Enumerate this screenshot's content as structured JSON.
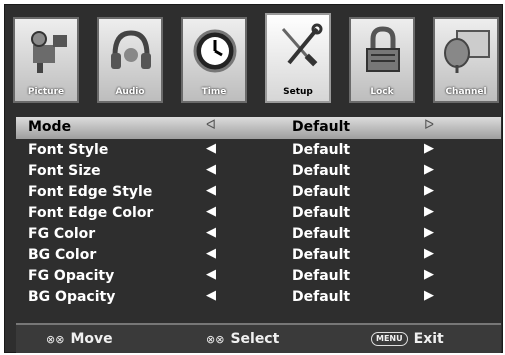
{
  "tabs": [
    {
      "label": "Picture",
      "icon": "camera-icon"
    },
    {
      "label": "Audio",
      "icon": "headphones-icon"
    },
    {
      "label": "Time",
      "icon": "clock-icon"
    },
    {
      "label": "Setup",
      "icon": "wrench-screwdriver-icon",
      "active": true
    },
    {
      "label": "Lock",
      "icon": "padlock-icon"
    },
    {
      "label": "Channel",
      "icon": "satellite-dish-icon"
    }
  ],
  "rows": [
    {
      "name": "Mode",
      "value": "Default",
      "selected": true
    },
    {
      "name": "Font Style",
      "value": "Default"
    },
    {
      "name": "Font Size",
      "value": "Default"
    },
    {
      "name": "Font Edge Style",
      "value": "Default"
    },
    {
      "name": "Font Edge Color",
      "value": "Default"
    },
    {
      "name": "FG Color",
      "value": "Default"
    },
    {
      "name": "BG Color",
      "value": "Default"
    },
    {
      "name": "FG Opacity",
      "value": "Default"
    },
    {
      "name": "BG Opacity",
      "value": "Default"
    }
  ],
  "arrows": {
    "left": "◀",
    "right": "▶",
    "left_sel": "ᐊ",
    "right_sel": "ᐅ"
  },
  "footer": {
    "move": {
      "symbol": "⊗⊗",
      "label": "Move"
    },
    "select": {
      "symbol": "⊗⊗",
      "label": "Select"
    },
    "exit": {
      "key": "MENU",
      "label": "Exit"
    }
  },
  "colors": {
    "panel": "#2e2e2e",
    "highlight": "#c8c8c8",
    "text": "#ffffff"
  }
}
